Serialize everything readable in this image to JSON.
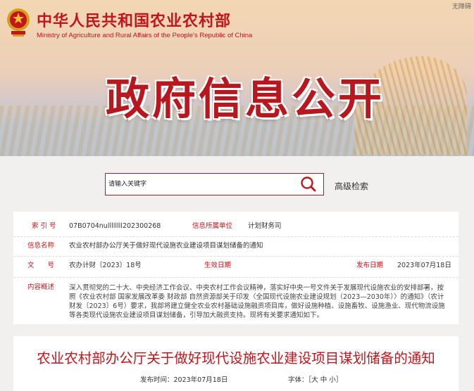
{
  "header": {
    "ministry_cn": "中华人民共和国农业农村部",
    "ministry_en": "Ministry of Agriculture and Rural Affairs of the People's Republic of China",
    "barrier_free": "无障碍",
    "banner_title": "政府信息公开"
  },
  "search": {
    "placeholder": "请输入关键字",
    "advanced_label": "高级检索"
  },
  "info": {
    "index_label": "索 引 号",
    "index_value": "07B0704nullllllll202300268",
    "publisher_label": "信息所属单位",
    "publisher_value": "计划财务司",
    "name_label": "信息名称",
    "name_value": "农业农村部办公厅关于做好现代设施农业建设项目谋划储备的通知",
    "docno_label": "文　　号",
    "docno_value": "农办计财〔2023〕18号",
    "effective_label": "生效日期",
    "effective_value": "",
    "release_label": "发布日期",
    "release_value": "2023年07月18日",
    "summary_label": "内容概述",
    "summary_value": "深入贯彻党的二十大、中央经济工作会议、中央农村工作会议精神，落实好中央一号文件关于发展现代设施农业的安排部署，按照《农业农村部 国家发展改革委 财政部 自然资源部关于印发〈全国现代设施农业建设规划（2023—2030年）〉的通知》（农计财发〔2023〕6号）要求，我部将建立健全农业农村基础设施融资项目库，做好设施种植、设施畜牧、设施渔业、现代物流设施等各类现代设施农业建设项目谋划储备，引导加大融资支持。现将有关要求通知如下。"
  },
  "article": {
    "title": "农业农村部办公厅关于做好现代设施农业建设项目谋划储备的通知",
    "date_label": "发布时间：2023年07月18日",
    "font_label": "字体：［大 中 小］"
  },
  "colors": {
    "brand_red": "#c0161c"
  }
}
